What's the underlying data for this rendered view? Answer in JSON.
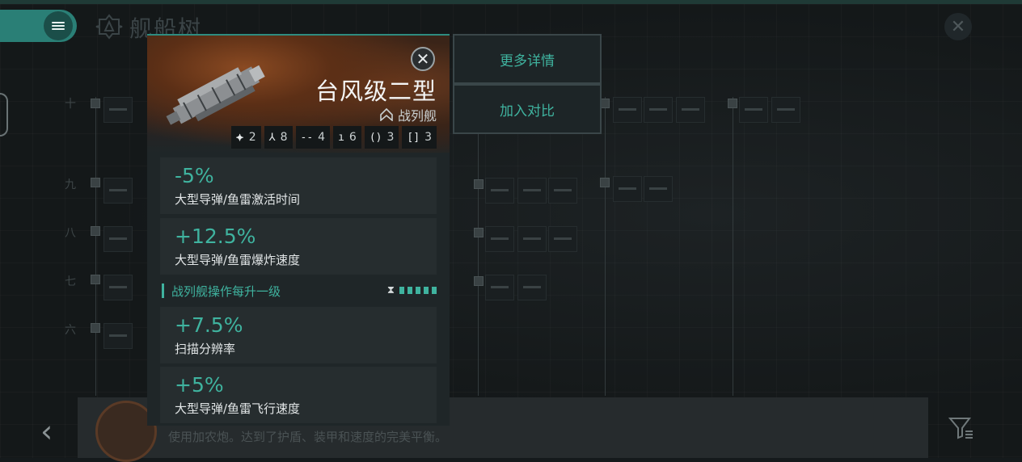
{
  "page": {
    "title": "舰船树",
    "description": "使用加农炮。达到了护盾、装甲和速度的完美平衡。"
  },
  "tiers": [
    "十",
    "九",
    "八",
    "七",
    "六"
  ],
  "popup": {
    "ship_name": "台风级二型",
    "ship_class": "战列舰",
    "slots": [
      {
        "icon": "drone-icon",
        "glyph": "⯌",
        "value": "2"
      },
      {
        "icon": "turret-icon",
        "glyph": "⅄",
        "value": "8"
      },
      {
        "icon": "high-slot-icon",
        "glyph": "--",
        "value": "4"
      },
      {
        "icon": "mid-slot-icon",
        "glyph": "ı",
        "value": "6"
      },
      {
        "icon": "low-slot-icon",
        "glyph": "()",
        "value": "3"
      },
      {
        "icon": "rig-slot-icon",
        "glyph": "[]",
        "value": "3"
      }
    ],
    "bonuses": [
      {
        "value": "-5%",
        "desc": "大型导弹/鱼雷激活时间"
      },
      {
        "value": "+12.5%",
        "desc": "大型导弹/鱼雷爆炸速度"
      }
    ],
    "skill_header": "战列舰操作每升一级",
    "skill_bonuses": [
      {
        "value": "+7.5%",
        "desc": "扫描分辨率"
      },
      {
        "value": "+5%",
        "desc": "大型导弹/鱼雷飞行速度"
      }
    ]
  },
  "actions": {
    "more_details": "更多详情",
    "add_compare": "加入对比"
  },
  "colors": {
    "accent": "#3fb39f",
    "menu": "#2a7f76",
    "background": "#151a1c"
  }
}
